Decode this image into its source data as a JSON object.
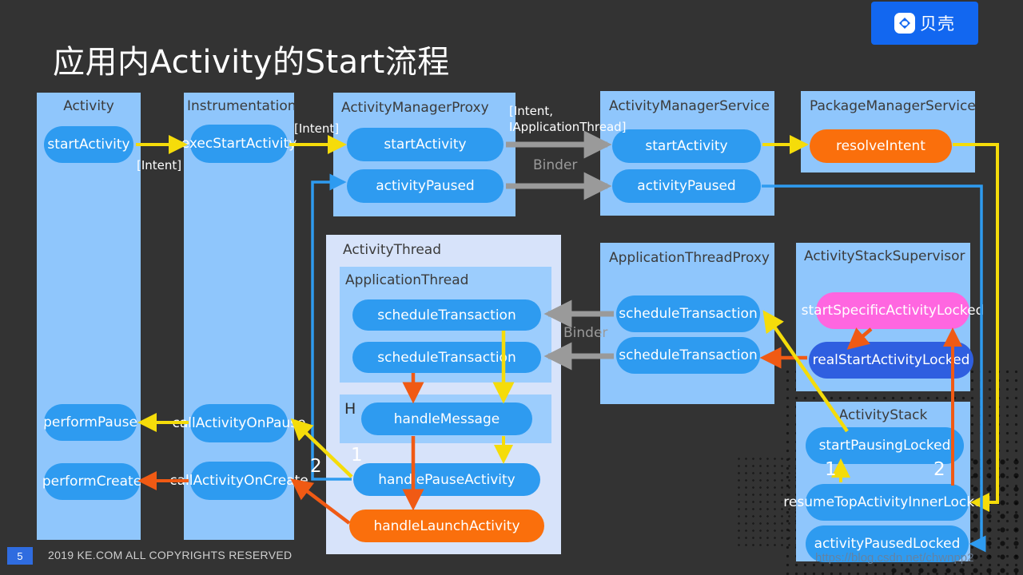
{
  "slide": {
    "title": "应用内Activity的Start流程",
    "page_number": "5",
    "footer": "2019 KE.COM ALL COPYRIGHTS RESERVED",
    "watermark": "https://blog.csdn.net/chwnpp2",
    "background_color": "#333333"
  },
  "logo": {
    "name": "贝壳",
    "icon": "shell-house-icon",
    "color": "#1267F0"
  },
  "colors": {
    "panel": "#8FC6FC",
    "panel_light": "#D7E3FA",
    "panel_inner": "#9CCDFD",
    "pill_blue": "#2E9BF0",
    "pill_orange": "#FA6F0C",
    "pill_pink": "#FF66E0",
    "pill_royal": "#2F5FE0",
    "arrow_yellow": "#F5DC0A",
    "arrow_orange": "#F05A14",
    "arrow_blue": "#2E9BF0",
    "arrow_grey": "#9A9A9A"
  },
  "panels": [
    {
      "id": "activity",
      "title": "Activity",
      "methods": [
        "startActivity",
        "performPause",
        "performCreate"
      ]
    },
    {
      "id": "instrumentation",
      "title": "Instrumentation",
      "methods": [
        "execStartActivity",
        "callActivityOnPause",
        "callActivityOnCreate"
      ]
    },
    {
      "id": "activity_manager_proxy",
      "title": "ActivityManagerProxy",
      "methods": [
        "startActivity",
        "activityPaused"
      ]
    },
    {
      "id": "activity_manager_service",
      "title": "ActivityManagerService",
      "methods": [
        "startActivity",
        "activityPaused"
      ]
    },
    {
      "id": "package_manager_service",
      "title": "PackageManagerService",
      "methods": [
        "resolveIntent"
      ]
    },
    {
      "id": "activity_thread",
      "title": "ActivityThread",
      "methods": [
        "handlePauseActivity",
        "handleLaunchActivity"
      ]
    },
    {
      "id": "application_thread",
      "title": "ApplicationThread",
      "methods": [
        "scheduleTransaction",
        "scheduleTransaction"
      ]
    },
    {
      "id": "handler_h",
      "title": "H",
      "methods": [
        "handleMessage"
      ]
    },
    {
      "id": "application_thread_proxy",
      "title": "ApplicationThreadProxy",
      "methods": [
        "scheduleTransaction",
        "scheduleTransaction"
      ]
    },
    {
      "id": "activity_stack_supervisor",
      "title": "ActivityStackSupervisor",
      "methods": [
        "startSpecificActivityLocked",
        "realStartActivityLocked"
      ]
    },
    {
      "id": "activity_stack",
      "title": "ActivityStack",
      "methods": [
        "startPausingLocked",
        "resumeTopActivityInnerLocked",
        "activityPausedLocked"
      ]
    }
  ],
  "nodes": {
    "activity_title": "Activity",
    "start_activity": "startActivity",
    "perform_pause": "performPause",
    "perform_create": "performCreate",
    "instrumentation_title": "Instrumentation",
    "exec_start_activity": "execStartActivity",
    "call_activity_on_pause": "callActivityOnPause",
    "call_activity_on_create": "callActivityOnCreate",
    "amp_title": "ActivityManagerProxy",
    "amp_start_activity": "startActivity",
    "amp_activity_paused": "activityPaused",
    "ams_title": "ActivityManagerService",
    "ams_start_activity": "startActivity",
    "ams_activity_paused": "activityPaused",
    "pms_title": "PackageManagerService",
    "resolve_intent": "resolveIntent",
    "activity_thread_title": "ActivityThread",
    "application_thread_title": "ApplicationThread",
    "schedule_transaction_1": "scheduleTransaction",
    "schedule_transaction_2": "scheduleTransaction",
    "h_title": "H",
    "handle_message": "handleMessage",
    "handle_pause_activity": "handlePauseActivity",
    "handle_launch_activity": "handleLaunchActivity",
    "atp_title": "ApplicationThreadProxy",
    "atp_schedule_transaction_1": "scheduleTransaction",
    "atp_schedule_transaction_2": "scheduleTransaction",
    "ass_title": "ActivityStackSupervisor",
    "start_specific_activity_locked": "startSpecificActivityLocked",
    "real_start_activity_locked": "realStartActivityLocked",
    "as_title": "ActivityStack",
    "start_pausing_locked": "startPausingLocked",
    "resume_top_activity_inner_locked": "resumeTopActivityInnerLocked",
    "activity_paused_locked": "activityPausedLocked"
  },
  "labels": {
    "intent_1": "[Intent]",
    "intent_2": "[Intent]",
    "intent_app_thread": "[Intent,\nIApplicationThread]",
    "binder_top": "Binder",
    "binder_mid": "Binder",
    "seq_thread_1": "1",
    "seq_thread_2": "2",
    "seq_stack_1": "1",
    "seq_stack_2": "2"
  }
}
